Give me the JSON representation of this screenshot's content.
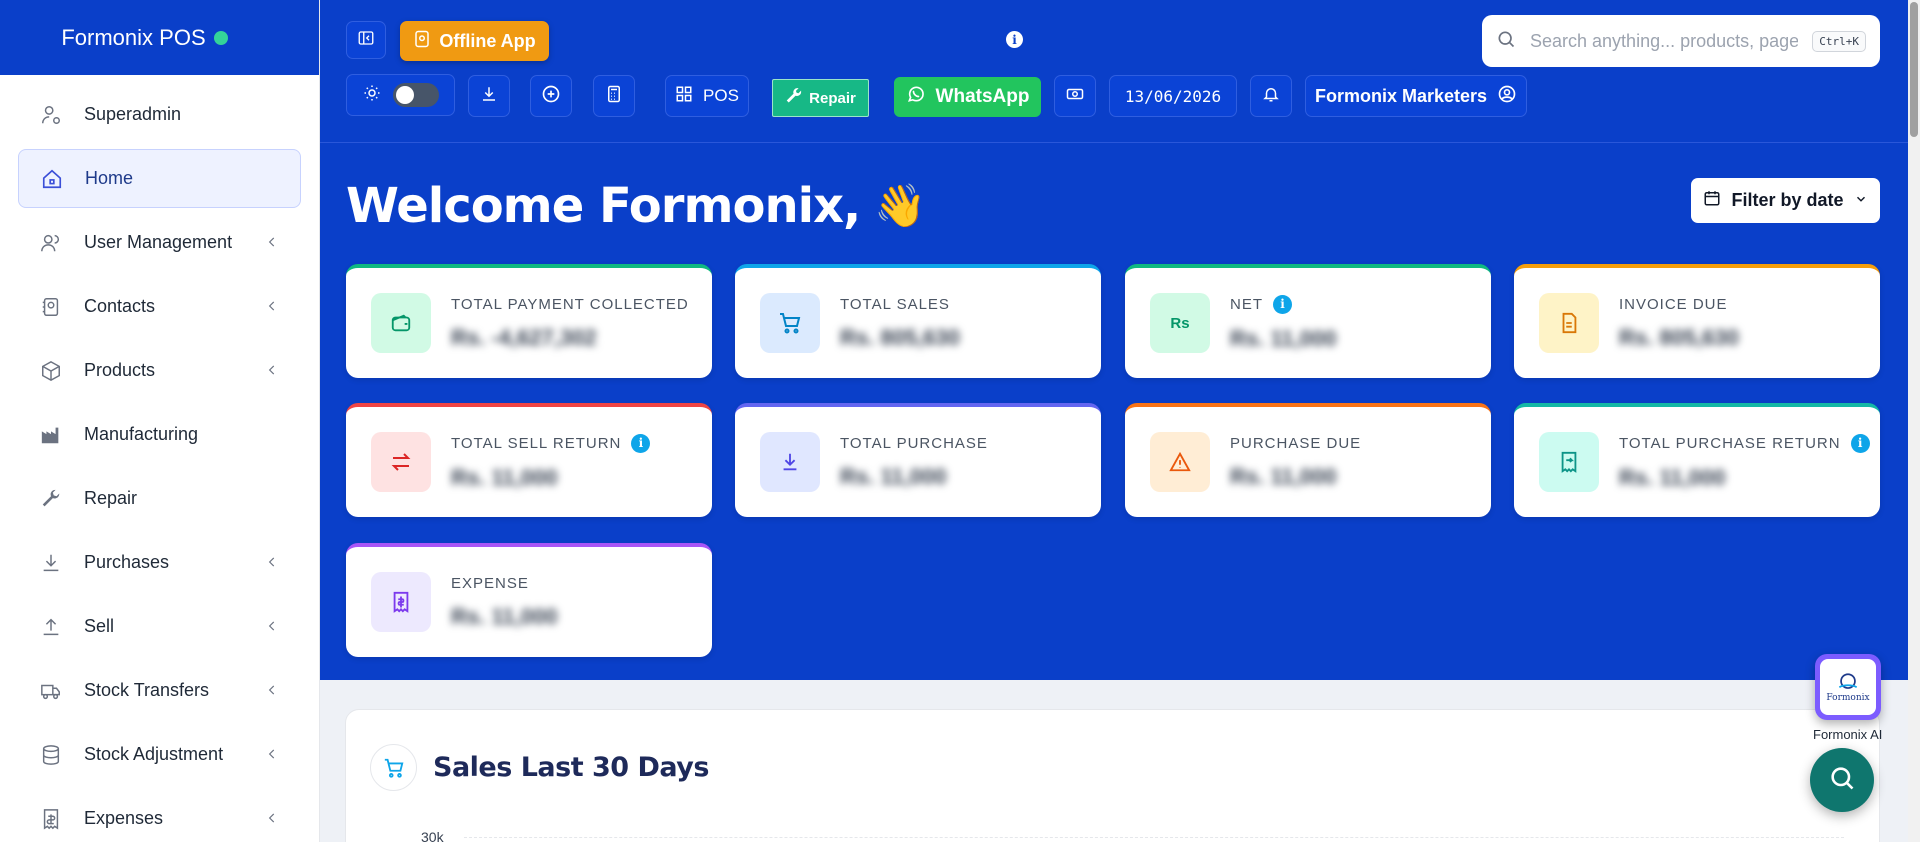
{
  "brand": {
    "name": "Formonix POS",
    "status_color": "#34d399"
  },
  "sidebar": {
    "items": [
      {
        "label": "Superadmin",
        "icon": "user-gear-icon",
        "active": false,
        "chevron": false
      },
      {
        "label": "Home",
        "icon": "home-icon",
        "active": true,
        "chevron": false
      },
      {
        "label": "User Management",
        "icon": "users-icon",
        "active": false,
        "chevron": true
      },
      {
        "label": "Contacts",
        "icon": "contacts-icon",
        "active": false,
        "chevron": true
      },
      {
        "label": "Products",
        "icon": "box-icon",
        "active": false,
        "chevron": true
      },
      {
        "label": "Manufacturing",
        "icon": "factory-icon",
        "active": false,
        "chevron": false
      },
      {
        "label": "Repair",
        "icon": "wrench-icon",
        "active": false,
        "chevron": false
      },
      {
        "label": "Purchases",
        "icon": "download-icon",
        "active": false,
        "chevron": true
      },
      {
        "label": "Sell",
        "icon": "upload-icon",
        "active": false,
        "chevron": true
      },
      {
        "label": "Stock Transfers",
        "icon": "truck-icon",
        "active": false,
        "chevron": true
      },
      {
        "label": "Stock Adjustment",
        "icon": "database-icon",
        "active": false,
        "chevron": true
      },
      {
        "label": "Expenses",
        "icon": "receipt-icon",
        "active": false,
        "chevron": true
      }
    ]
  },
  "toolbar": {
    "offline_label": "Offline App",
    "pos_label": "POS",
    "repair_label": "Repair",
    "whatsapp_label": "WhatsApp",
    "date": "13/06/2026",
    "user_label": "Formonix Marketers"
  },
  "search": {
    "placeholder": "Search anything... products, pages",
    "shortcut": "Ctrl+K"
  },
  "welcome": {
    "text": "Welcome Formonix,",
    "emoji": "👋"
  },
  "filter": {
    "label": "Filter by date"
  },
  "stats": [
    {
      "label": "TOTAL PAYMENT COLLECTED",
      "value": "Rs. -4,627,302",
      "accent": "#10b981",
      "icon_bg": "#d1fae5",
      "icon": "wallet-icon",
      "info": false
    },
    {
      "label": "TOTAL SALES",
      "value": "Rs. 805,630",
      "accent": "#0ea5e9",
      "icon_bg": "#dbeafe",
      "icon": "cart-icon",
      "info": false
    },
    {
      "label": "NET",
      "value": "Rs. 11,000",
      "accent": "#10b981",
      "icon_bg": "#d1fae5",
      "icon": "rupee-icon",
      "info": true
    },
    {
      "label": "INVOICE DUE",
      "value": "Rs. 805,630",
      "accent": "#f59e0b",
      "icon_bg": "#fef3c7",
      "icon": "invoice-icon",
      "info": false
    },
    {
      "label": "TOTAL SELL RETURN",
      "value": "Rs. 11,000",
      "accent": "#ef4444",
      "icon_bg": "#fee2e2",
      "icon": "swap-icon",
      "info": true
    },
    {
      "label": "TOTAL PURCHASE",
      "value": "Rs. 11,000",
      "accent": "#6366f1",
      "icon_bg": "#e0e7ff",
      "icon": "download-icon",
      "info": false
    },
    {
      "label": "PURCHASE DUE",
      "value": "Rs. 11,000",
      "accent": "#f97316",
      "icon_bg": "#ffedd5",
      "icon": "warning-icon",
      "info": false
    },
    {
      "label": "TOTAL PURCHASE RETURN",
      "value": "Rs. 11,000",
      "accent": "#14b8a6",
      "icon_bg": "#ccfbf1",
      "icon": "receipt-return-icon",
      "info": true
    },
    {
      "label": "EXPENSE",
      "value": "Rs. 11,000",
      "accent": "#a855f7",
      "icon_bg": "#ede9fe",
      "icon": "expense-icon",
      "info": false
    }
  ],
  "sales_panel": {
    "title": "Sales Last 30 Days",
    "y_tick": "30k"
  },
  "ai": {
    "label": "Formonix AI",
    "logo_text": "Formonix"
  }
}
